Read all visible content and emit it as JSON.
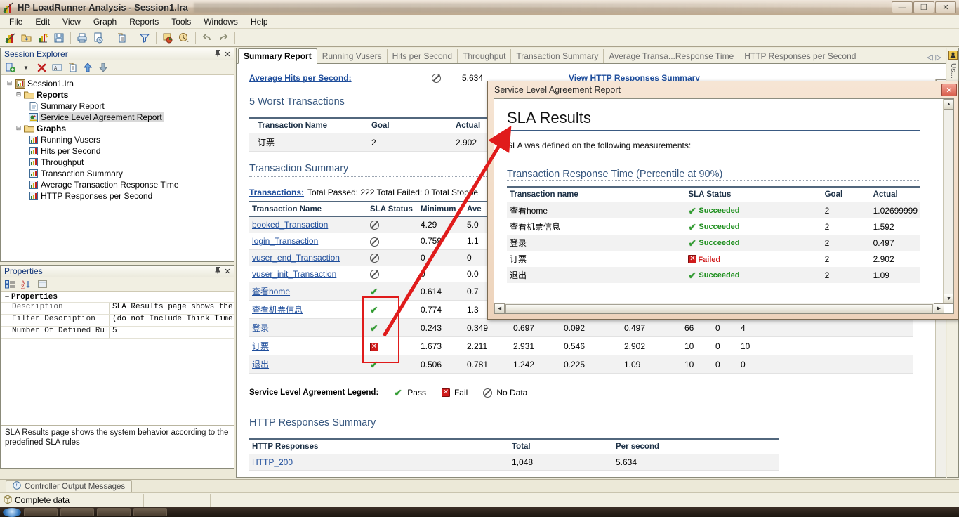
{
  "window": {
    "title": "HP LoadRunner Analysis - Session1.lra",
    "app_icon": "loadrunner-icon",
    "minimize": "—",
    "restore": "❐",
    "close": "✕"
  },
  "menu": {
    "items": [
      "File",
      "Edit",
      "View",
      "Graph",
      "Reports",
      "Tools",
      "Windows",
      "Help"
    ]
  },
  "toolbar": {
    "buttons": [
      {
        "name": "new-analysis-session-icon",
        "glyph": "📊"
      },
      {
        "name": "open-session-icon",
        "glyph": "📂"
      },
      {
        "name": "new-graph-icon",
        "glyph": "📈"
      },
      {
        "name": "save-icon",
        "glyph": "💾"
      },
      {
        "name": "print-icon",
        "glyph": "🖨"
      },
      {
        "name": "print-preview-icon",
        "glyph": "📄"
      },
      {
        "name": "copy-icon",
        "glyph": "⧉"
      },
      {
        "name": "set-filter-icon",
        "glyph": "▽"
      },
      {
        "name": "merge-graphs-icon",
        "glyph": "❖"
      },
      {
        "name": "set-granularity-icon",
        "glyph": "⏱"
      },
      {
        "name": "undo-icon",
        "glyph": "↩"
      },
      {
        "name": "redo-icon",
        "glyph": "↪"
      }
    ]
  },
  "session_explorer": {
    "title": "Session Explorer",
    "pin": "📌",
    "close": "✕",
    "toolbar_buttons": [
      {
        "name": "add-new-item-icon",
        "glyph": "➕"
      },
      {
        "name": "dropdown-arrow-icon",
        "glyph": "▼"
      },
      {
        "name": "delete-item-icon",
        "glyph": "✖"
      },
      {
        "name": "rename-item-icon",
        "glyph": "▭"
      },
      {
        "name": "duplicate-item-icon",
        "glyph": "⧉"
      },
      {
        "name": "move-up-icon",
        "glyph": "↑"
      },
      {
        "name": "move-down-icon",
        "glyph": "↓"
      }
    ],
    "tree": {
      "root": "Session1.lra",
      "groups": [
        {
          "label": "Reports",
          "items": [
            {
              "label": "Summary Report",
              "icon": "document-icon",
              "selected": false
            },
            {
              "label": "Service Level Agreement Report",
              "icon": "sla-report-icon",
              "selected": true
            }
          ]
        },
        {
          "label": "Graphs",
          "items": [
            {
              "label": "Running Vusers",
              "icon": "bar-chart-icon",
              "selected": false
            },
            {
              "label": "Hits per Second",
              "icon": "bar-chart-icon",
              "selected": false
            },
            {
              "label": "Throughput",
              "icon": "bar-chart-icon",
              "selected": false
            },
            {
              "label": "Transaction Summary",
              "icon": "bar-chart-icon",
              "selected": false
            },
            {
              "label": "Average Transaction Response Time",
              "icon": "bar-chart-icon",
              "selected": false
            },
            {
              "label": "HTTP Responses per Second",
              "icon": "bar-chart-icon",
              "selected": false
            }
          ]
        }
      ]
    }
  },
  "properties_panel": {
    "title": "Properties",
    "pin": "📌",
    "close": "✕",
    "toolbar_buttons": [
      {
        "name": "categorized-view-icon",
        "glyph": "☷"
      },
      {
        "name": "alphabetical-sort-icon",
        "glyph": "A↓"
      },
      {
        "name": "property-pages-icon",
        "glyph": "▤"
      }
    ],
    "category": "Properties",
    "category_expander": "−",
    "rows": [
      {
        "key": "Description",
        "value": "SLA Results page shows the s…"
      },
      {
        "key": "Filter Description",
        "value": "(do not Include Think Time)"
      },
      {
        "key": "Number Of Defined Rules",
        "value": "5"
      }
    ],
    "description_text": "SLA Results page shows the system behavior according to the predefined SLA rules"
  },
  "tabs": {
    "items": [
      {
        "label": "Summary Report",
        "active": true
      },
      {
        "label": "Running Vusers",
        "active": false
      },
      {
        "label": "Hits per Second",
        "active": false
      },
      {
        "label": "Throughput",
        "active": false
      },
      {
        "label": "Transaction Summary",
        "active": false
      },
      {
        "label": "Average Transa...Response Time",
        "active": false
      },
      {
        "label": "HTTP Responses per Second",
        "active": false
      }
    ],
    "nav_prev": "◁",
    "nav_next": "▷"
  },
  "right_bar": {
    "icon": "user-settings-icon",
    "label": "Us…"
  },
  "report": {
    "avg_hits_label": "Average Hits per Second:",
    "avg_hits_status_icon": "no-data-icon",
    "avg_hits_value": "5.634",
    "view_http_link": "View HTTP Responses Summary",
    "worst_transactions": {
      "title": "5 Worst Transactions",
      "columns": [
        "Transaction Name",
        "Goal",
        "Actual"
      ],
      "rows": [
        {
          "name": "订票",
          "goal": "2",
          "actual": "2.902"
        }
      ]
    },
    "transaction_summary": {
      "title": "Transaction Summary",
      "summary_link": "Transactions:",
      "summary_text": "Total Passed: 222 Total Failed: 0 Total Stoppe",
      "columns": [
        "Transaction Name",
        "SLA Status",
        "Minimum",
        "Ave"
      ],
      "rows": [
        {
          "name": "booked_Transaction",
          "status": "no-data",
          "minimum": "4.29",
          "average": "5.0",
          "maximum": "",
          "stddev": "",
          "percentile90": "",
          "pass": "",
          "fail": "",
          "stop": ""
        },
        {
          "name": "login_Transaction",
          "status": "no-data",
          "minimum": "0.759",
          "average": "1.1",
          "maximum": "",
          "stddev": "",
          "percentile90": "",
          "pass": "",
          "fail": "",
          "stop": ""
        },
        {
          "name": "vuser_end_Transaction",
          "status": "no-data",
          "minimum": "0",
          "average": "0",
          "maximum": "",
          "stddev": "",
          "percentile90": "",
          "pass": "",
          "fail": "",
          "stop": ""
        },
        {
          "name": "vuser_init_Transaction",
          "status": "no-data",
          "minimum": "0",
          "average": "0.0",
          "maximum": "",
          "stddev": "",
          "percentile90": "",
          "pass": "",
          "fail": "",
          "stop": ""
        },
        {
          "name": "查看home",
          "status": "pass",
          "minimum": "0.614",
          "average": "0.7",
          "maximum": "",
          "stddev": "",
          "percentile90": "",
          "pass": "",
          "fail": "",
          "stop": ""
        },
        {
          "name": "查看机票信息",
          "status": "pass",
          "minimum": "0.774",
          "average": "1.3",
          "maximum": "",
          "stddev": "",
          "percentile90": "",
          "pass": "",
          "fail": "",
          "stop": ""
        },
        {
          "name": "登录",
          "status": "pass",
          "minimum": "0.243",
          "average": "0.349",
          "maximum": "0.697",
          "stddev": "0.092",
          "percentile90": "0.497",
          "pass": "66",
          "fail": "0",
          "stop": "4"
        },
        {
          "name": "订票",
          "status": "fail",
          "minimum": "1.673",
          "average": "2.211",
          "maximum": "2.931",
          "stddev": "0.546",
          "percentile90": "2.902",
          "pass": "10",
          "fail": "0",
          "stop": "10"
        },
        {
          "name": "退出",
          "status": "pass",
          "minimum": "0.506",
          "average": "0.781",
          "maximum": "1.242",
          "stddev": "0.225",
          "percentile90": "1.09",
          "pass": "10",
          "fail": "0",
          "stop": "0"
        }
      ]
    },
    "legend": {
      "label": "Service Level Agreement Legend:",
      "items": [
        {
          "icon": "pass-icon",
          "label": "Pass"
        },
        {
          "icon": "fail-icon",
          "label": "Fail"
        },
        {
          "icon": "no-data-icon",
          "label": "No Data"
        }
      ]
    },
    "http_summary": {
      "title": "HTTP Responses Summary",
      "columns": [
        "HTTP Responses",
        "Total",
        "Per second"
      ],
      "rows": [
        {
          "code": "HTTP_200",
          "total": "1,048",
          "per_second": "5.634"
        }
      ]
    }
  },
  "sla_window": {
    "title": "Service Level Agreement Report",
    "close": "✕",
    "heading": "SLA Results",
    "note": "SLA was defined on the following measurements:",
    "section_title": "Transaction Response Time (Percentile at 90%)",
    "columns": [
      "Transaction name",
      "SLA Status",
      "Goal",
      "Actual"
    ],
    "rows": [
      {
        "name": "查看home",
        "status": "Succeeded",
        "status_kind": "pass",
        "goal": "2",
        "actual": "1.02699999"
      },
      {
        "name": "查看机票信息",
        "status": "Succeeded",
        "status_kind": "pass",
        "goal": "2",
        "actual": "1.592"
      },
      {
        "name": "登录",
        "status": "Succeeded",
        "status_kind": "pass",
        "goal": "2",
        "actual": "0.497"
      },
      {
        "name": "订票",
        "status": "Failed",
        "status_kind": "fail",
        "goal": "2",
        "actual": "2.902"
      },
      {
        "name": "退出",
        "status": "Succeeded",
        "status_kind": "pass",
        "goal": "2",
        "actual": "1.09"
      }
    ],
    "scroll_left": "◀",
    "scroll_right": "▶",
    "scroll_up": "▲",
    "scroll_down": "▼"
  },
  "bottom": {
    "output_tab": "Controller Output Messages",
    "output_tab_icon": "message-icon",
    "status_icon": "data-cube-icon",
    "status_text": "Complete data"
  },
  "colors": {
    "accent": "#1f4e9c",
    "pass": "#2f9e2f",
    "fail": "#d01b1b",
    "section": "#37577f",
    "annotation": "#e01b1b"
  }
}
